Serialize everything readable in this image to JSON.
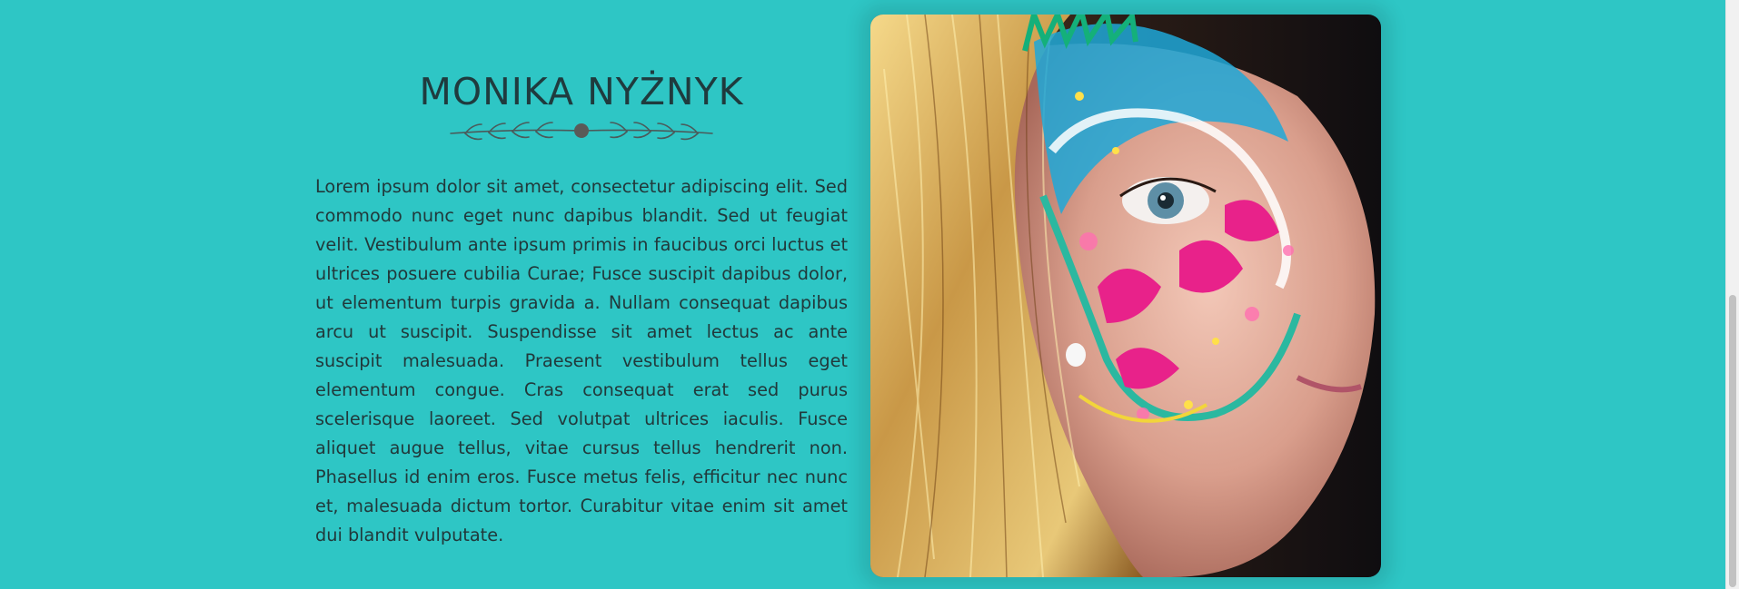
{
  "colors": {
    "background": "#2ec6c5",
    "title": "#1f3b3e",
    "body_text": "#21393b",
    "divider": "#4b5a5a"
  },
  "about": {
    "title": "MONIKA NYŻNYK",
    "divider_icon": "leaf-branch-ornament-icon",
    "paragraph": "Lorem ipsum dolor sit amet, consectetur adipiscing elit. Sed commodo nunc eget nunc dapibus blandit. Sed ut feugiat velit. Vestibulum ante ipsum primis in faucibus orci luctus et ultrices posuere cubilia Curae; Fusce suscipit dapibus dolor, ut elementum turpis gravida a. Nullam consequat dapibus arcu ut suscipit. Suspendisse sit amet lectus ac ante suscipit malesuada. Praesent vestibulum tellus eget elementum congue. Cras consequat erat sed purus scelerisque laoreet. Sed volutpat ultrices iaculis. Fusce aliquet augue tellus, vitae cursus tellus hendrerit non. Phasellus id enim eros. Fusce metus felis, efficitur nec nunc et, malesuada dictum tortor. Curabitur vitae enim sit amet dui blandit vulputate."
  },
  "photo": {
    "subject": "woman-with-colorful-face-paint-photo"
  }
}
